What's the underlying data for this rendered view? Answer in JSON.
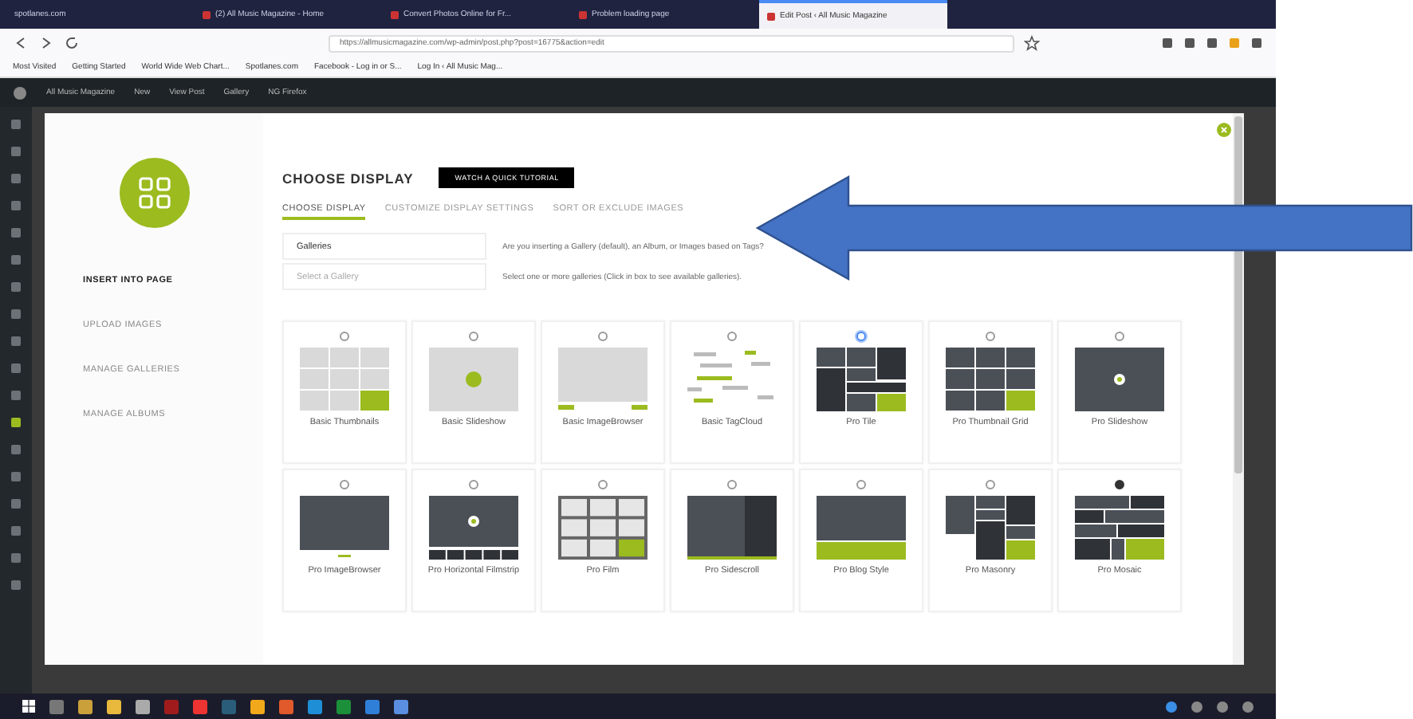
{
  "browser": {
    "tabs": [
      {
        "title": "spotlanes.com",
        "selected": false
      },
      {
        "title": "(2) All Music Magazine - Home",
        "selected": false
      },
      {
        "title": "Convert Photos Online for Fr...",
        "selected": false
      },
      {
        "title": "Problem loading page",
        "selected": false
      },
      {
        "title": "Edit Post ‹ All Music Magazine",
        "selected": true
      }
    ],
    "address": "https://allmusicmagazine.com/wp-admin/post.php?post=16775&action=edit",
    "bookmarks": [
      "Most Visited",
      "Getting Started",
      "World Wide Web Chart...",
      "Spotlanes.com",
      "Facebook - Log in or S...",
      "Log In ‹ All Music Mag..."
    ]
  },
  "admin_bar": {
    "items": [
      "All Music Magazine",
      "New",
      "View Post",
      "Gallery",
      "NG Firefox"
    ]
  },
  "modal": {
    "sidebar": [
      {
        "label": "INSERT INTO PAGE",
        "selected": true
      },
      {
        "label": "UPLOAD IMAGES",
        "selected": false
      },
      {
        "label": "MANAGE GALLERIES",
        "selected": false
      },
      {
        "label": "MANAGE ALBUMS",
        "selected": false
      }
    ],
    "title": "CHOOSE DISPLAY",
    "tutorial_button": "WATCH A QUICK TUTORIAL",
    "tabs": [
      {
        "label": "CHOOSE DISPLAY",
        "selected": true
      },
      {
        "label": "CUSTOMIZE DISPLAY SETTINGS",
        "selected": false
      },
      {
        "label": "SORT OR EXCLUDE IMAGES",
        "selected": false
      }
    ],
    "fields": [
      {
        "value": "Galleries",
        "help": "Are you inserting a Gallery (default), an Album, or Images based on Tags?"
      },
      {
        "placeholder": "Select a Gallery",
        "help": "Select one or more galleries (Click in box to see available galleries)."
      }
    ],
    "display_types": [
      {
        "label": "Basic Thumbnails",
        "kind": "grid",
        "dark": false,
        "selected": false,
        "focused": false
      },
      {
        "label": "Basic Slideshow",
        "kind": "slideshow",
        "dark": false,
        "selected": false,
        "focused": false
      },
      {
        "label": "Basic ImageBrowser",
        "kind": "browser",
        "dark": false,
        "selected": false,
        "focused": false
      },
      {
        "label": "Basic TagCloud",
        "kind": "tagcloud",
        "dark": false,
        "selected": false,
        "focused": false
      },
      {
        "label": "Pro Tile",
        "kind": "tile",
        "dark": true,
        "selected": false,
        "focused": true
      },
      {
        "label": "Pro Thumbnail Grid",
        "kind": "grid",
        "dark": true,
        "selected": false,
        "focused": false
      },
      {
        "label": "Pro Slideshow",
        "kind": "slideshow",
        "dark": true,
        "selected": false,
        "focused": false
      },
      {
        "label": "Pro ImageBrowser",
        "kind": "browser",
        "dark": true,
        "selected": false,
        "focused": false
      },
      {
        "label": "Pro Horizontal Filmstrip",
        "kind": "filmstrip",
        "dark": true,
        "selected": false,
        "focused": false
      },
      {
        "label": "Pro Film",
        "kind": "film",
        "dark": true,
        "selected": false,
        "focused": false
      },
      {
        "label": "Pro Sidescroll",
        "kind": "sidescroll",
        "dark": true,
        "selected": false,
        "focused": false
      },
      {
        "label": "Pro Blog Style",
        "kind": "blog",
        "dark": true,
        "selected": false,
        "focused": false
      },
      {
        "label": "Pro Masonry",
        "kind": "masonry",
        "dark": true,
        "selected": false,
        "focused": false
      },
      {
        "label": "Pro Mosaic",
        "kind": "mosaic",
        "dark": true,
        "selected": true,
        "focused": false
      }
    ]
  }
}
